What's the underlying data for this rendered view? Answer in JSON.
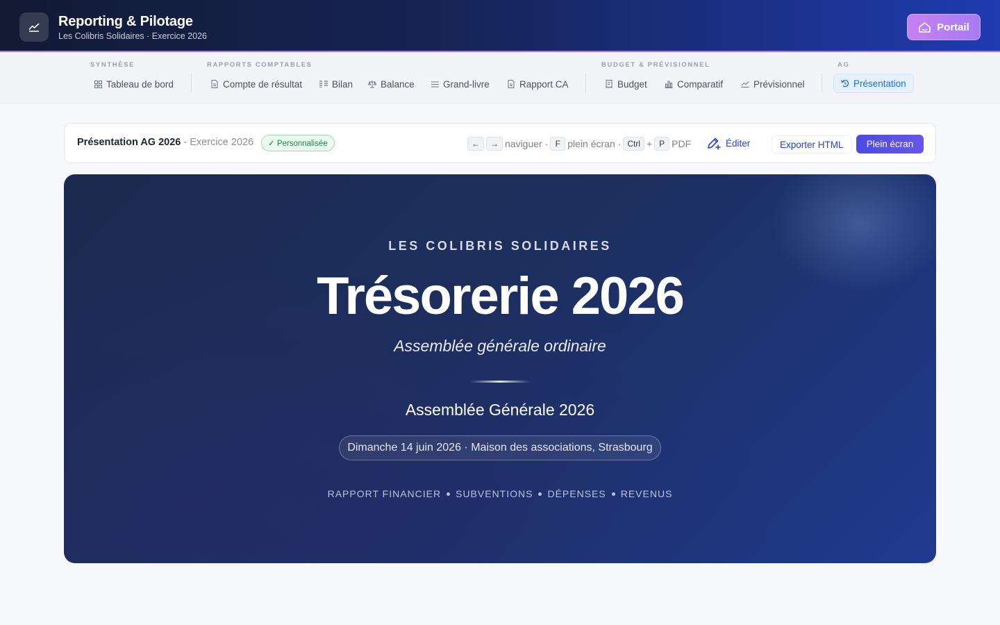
{
  "app": {
    "title": "Reporting & Pilotage",
    "subtitle": "Les Colibris Solidaires · Exercice 2026",
    "portal_label": "Portail"
  },
  "nav": {
    "groups": [
      {
        "label": "SYNTHÈSE",
        "items": [
          {
            "label": "Tableau de bord",
            "icon": "grid-icon"
          }
        ]
      },
      {
        "label": "RAPPORTS COMPTABLES",
        "items": [
          {
            "label": "Compte de résultat",
            "icon": "document-icon"
          },
          {
            "label": "Bilan",
            "icon": "columns-icon"
          },
          {
            "label": "Balance",
            "icon": "scale-icon"
          },
          {
            "label": "Grand-livre",
            "icon": "list-icon"
          },
          {
            "label": "Rapport CA",
            "icon": "document-icon"
          }
        ]
      },
      {
        "label": "BUDGET & PRÉVISIONNEL",
        "items": [
          {
            "label": "Budget",
            "icon": "receipt-icon"
          },
          {
            "label": "Comparatif",
            "icon": "bar-chart-icon"
          },
          {
            "label": "Prévisionnel",
            "icon": "trend-icon"
          }
        ]
      },
      {
        "label": "AG",
        "items": [
          {
            "label": "Présentation",
            "icon": "presentation-icon",
            "active": true
          }
        ]
      }
    ]
  },
  "toolbar": {
    "doc_title": "Présentation AG 2026",
    "doc_sep": " - ",
    "doc_exercise": "Exercice 2026",
    "badge": "✓ Personnalisée",
    "hints": {
      "key_left": "←",
      "key_right": "→",
      "navigate": "naviguer ·",
      "key_f": "F",
      "fullscreen": "plein écran ·",
      "key_ctrl": "Ctrl",
      "plus": "+",
      "key_p": "P",
      "pdf": "PDF"
    },
    "edit_label": "Éditer",
    "export_label": "Exporter HTML",
    "fullscreen_label": "Plein écran"
  },
  "slide": {
    "org": "LES COLIBRIS SOLIDAIRES",
    "title": "Trésorerie 2026",
    "subtitle": "Assemblée générale ordinaire",
    "ag_title": "Assemblée Générale 2026",
    "date_place": "Dimanche 14 juin 2026 · Maison des associations, Strasbourg",
    "topics": [
      "RAPPORT FINANCIER",
      "SUBVENTIONS",
      "DÉPENSES",
      "REVENUS"
    ]
  },
  "colors": {
    "accent": "#4b4be3",
    "header_start": "#121a33",
    "header_end": "#1f3bb0",
    "active_nav": "#1e6fd9",
    "badge_green": "#1f8a44"
  }
}
